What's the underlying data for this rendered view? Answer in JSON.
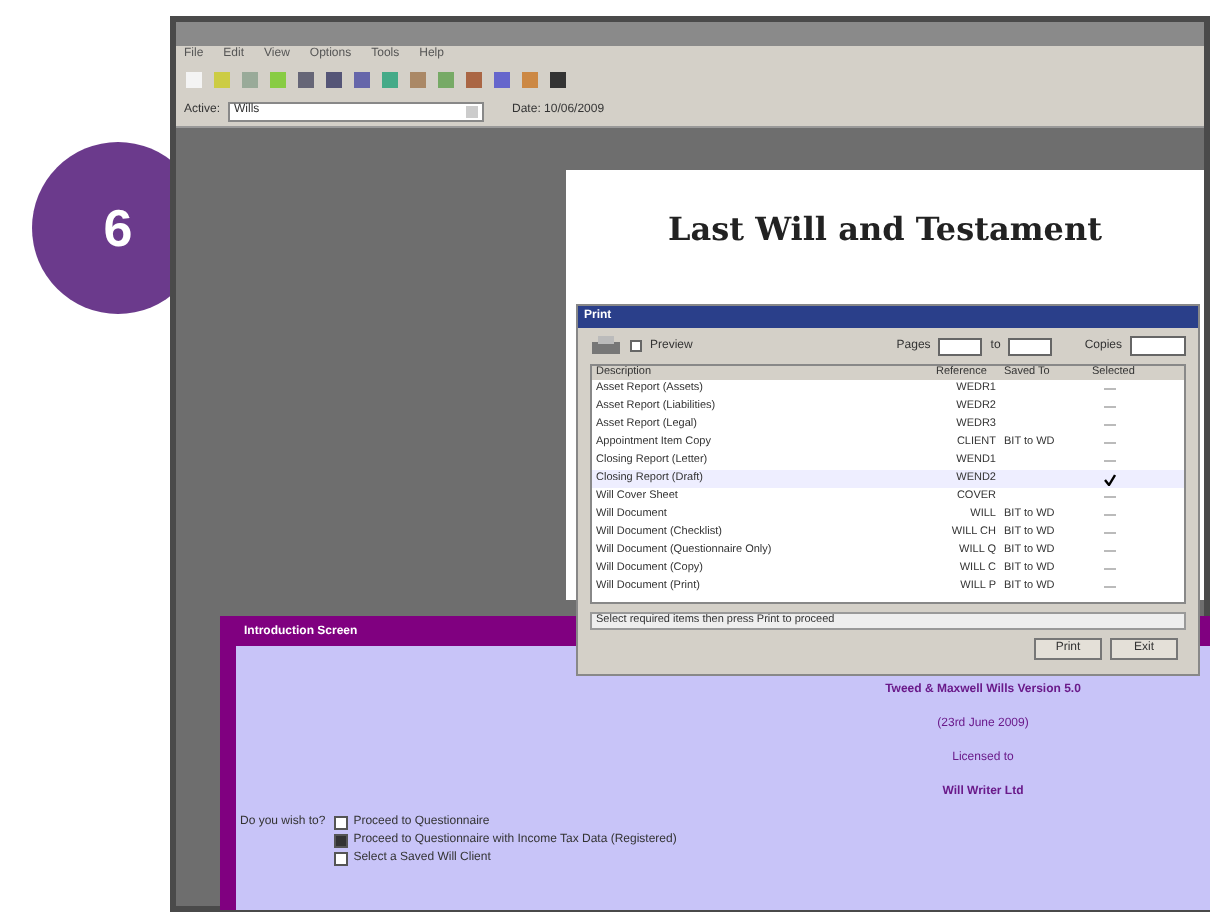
{
  "step_badge": "6",
  "app": {
    "menu": [
      "File",
      "Edit",
      "View",
      "Options",
      "Tools",
      "Help"
    ],
    "active_label": "Active:",
    "active_value": "Wills",
    "date_label": "Date: 10/06/2009"
  },
  "document": {
    "heading": "Last Will and Testament"
  },
  "print_dialog": {
    "title": "Print",
    "preview": {
      "label": "Preview",
      "checked": false
    },
    "pages_label": "Pages",
    "to_label": "to",
    "copies_label": "Copies",
    "columns": [
      "Description",
      "Reference",
      "Saved To",
      "Selected"
    ],
    "rows": [
      {
        "description": "Asset Report (Assets)",
        "reference": "WEDR1",
        "saved_to": "",
        "selected": false
      },
      {
        "description": "Asset Report (Liabilities)",
        "reference": "WEDR2",
        "saved_to": "",
        "selected": false
      },
      {
        "description": "Asset Report (Legal)",
        "reference": "WEDR3",
        "saved_to": "",
        "selected": false
      },
      {
        "description": "Appointment Item Copy",
        "reference": "CLIENT",
        "saved_to": "BIT to WD",
        "selected": false
      },
      {
        "description": "Closing Report (Letter)",
        "reference": "WEND1",
        "saved_to": "",
        "selected": false
      },
      {
        "description": "Closing Report (Draft)",
        "reference": "WEND2",
        "saved_to": "",
        "selected": true
      },
      {
        "description": "Will Cover Sheet",
        "reference": "COVER",
        "saved_to": "",
        "selected": false
      },
      {
        "description": "Will Document",
        "reference": "WILL",
        "saved_to": "BIT to WD",
        "selected": false
      },
      {
        "description": "Will Document (Checklist)",
        "reference": "WILL CH",
        "saved_to": "BIT to WD",
        "selected": false
      },
      {
        "description": "Will Document (Questionnaire Only)",
        "reference": "WILL Q",
        "saved_to": "BIT to WD",
        "selected": false
      },
      {
        "description": "Will Document (Copy)",
        "reference": "WILL C",
        "saved_to": "BIT to WD",
        "selected": false
      },
      {
        "description": "Will Document (Print)",
        "reference": "WILL P",
        "saved_to": "BIT to WD",
        "selected": false
      }
    ],
    "status": "Select required items then press Print to proceed",
    "buttons": [
      "Print",
      "Exit"
    ]
  },
  "intro": {
    "title": "Introduction Screen",
    "lines": [
      "Tweed & Maxwell Wills Version 5.0",
      "(23rd June 2009)",
      "Licensed to",
      "Will Writer Ltd"
    ],
    "question": "Do you wish to?",
    "options": [
      {
        "label": "Proceed to Questionnaire",
        "selected": false
      },
      {
        "label": "Proceed to Questionnaire with Income Tax Data (Registered)",
        "selected": true
      },
      {
        "label": "Select a Saved Will Client",
        "selected": false
      }
    ]
  }
}
